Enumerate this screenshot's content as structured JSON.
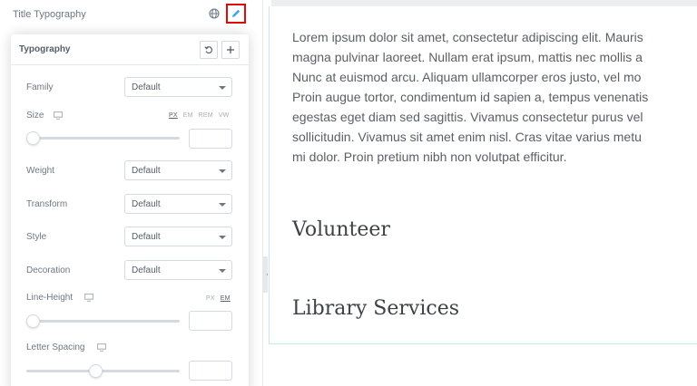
{
  "panel": {
    "control_label": "Title Typography",
    "popover": {
      "title": "Typography",
      "family": {
        "label": "Family",
        "value": "Default"
      },
      "size": {
        "label": "Size",
        "units": [
          "PX",
          "EM",
          "REM",
          "VW"
        ],
        "active_unit": "PX",
        "slider_fraction": 0
      },
      "weight": {
        "label": "Weight",
        "value": "Default"
      },
      "transform": {
        "label": "Transform",
        "value": "Default"
      },
      "style": {
        "label": "Style",
        "value": "Default"
      },
      "decoration": {
        "label": "Decoration",
        "value": "Default"
      },
      "line_height": {
        "label": "Line-Height",
        "units": [
          "PX",
          "EM"
        ],
        "active_unit": "EM",
        "slider_fraction": 0
      },
      "letter_spacing": {
        "label": "Letter Spacing",
        "slider_fraction": 0.45
      }
    }
  },
  "preview": {
    "paragraph_lines": [
      "Lorem ipsum dolor sit amet, consectetur adipiscing elit. Mauris",
      "magna pulvinar laoreet. Nullam erat ipsum, mattis nec mollis a",
      "Nunc at euismod arcu. Aliquam ullamcorper eros justo, vel mo",
      "Proin augue tortor, condimentum id sapien a, tempus venenatis",
      "egestas eget diam sed sagittis. Vivamus consectetur purus vel",
      "sollicitudin. Vivamus sit amet enim nisl. Cras vitae varius metu",
      "mi dolor. Proin pretium nibh non volutpat efficitur."
    ],
    "heading_1": "Volunteer",
    "heading_2": "Library Services"
  },
  "icons": {
    "globe": "globe-icon",
    "edit": "pencil-icon",
    "reset": "reset-icon",
    "add": "plus-icon",
    "device": "desktop-icon",
    "collapse": "chevron-left-icon"
  },
  "colors": {
    "edit_highlight": "#e00a0a",
    "preview_border": "#c5e8ef"
  }
}
